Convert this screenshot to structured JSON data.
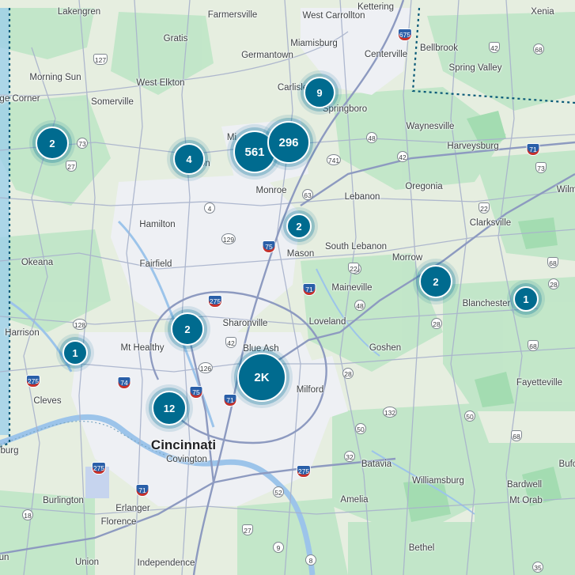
{
  "map": {
    "colors": {
      "land": "#e9efe4",
      "park": "#b9e7c4",
      "urban": "#eceef1",
      "road": "#9aa5c4",
      "water": "#a6c8ec",
      "cluster": "#006b8f",
      "boundary": "#0a5a78"
    },
    "places": [
      {
        "name": "Lakengren",
        "icon": "place-label"
      },
      {
        "name": "Farmersville",
        "icon": "place-label"
      },
      {
        "name": "West Carrollton",
        "icon": "place-label"
      },
      {
        "name": "Kettering",
        "icon": "place-label"
      },
      {
        "name": "Xenia",
        "icon": "place-label"
      },
      {
        "name": "Gratis",
        "icon": "place-label"
      },
      {
        "name": "Miamisburg",
        "icon": "place-label"
      },
      {
        "name": "Germantown",
        "icon": "place-label"
      },
      {
        "name": "Centerville",
        "icon": "place-label"
      },
      {
        "name": "Bellbrook",
        "icon": "place-label"
      },
      {
        "name": "Spring Valley",
        "icon": "place-label"
      },
      {
        "name": "Morning Sun",
        "icon": "place-label"
      },
      {
        "name": "West Elkton",
        "icon": "place-label"
      },
      {
        "name": "Carlisle",
        "icon": "place-label"
      },
      {
        "name": "ge Corner",
        "icon": "place-label"
      },
      {
        "name": "Somerville",
        "icon": "place-label"
      },
      {
        "name": "Springboro",
        "icon": "place-label"
      },
      {
        "name": "Waynesville",
        "icon": "place-label"
      },
      {
        "name": "Harveysburg",
        "icon": "place-label"
      },
      {
        "name": "Mi",
        "icon": "place-label"
      },
      {
        "name": "Trenton",
        "icon": "place-label"
      },
      {
        "name": "Oregonia",
        "icon": "place-label"
      },
      {
        "name": "Wilm",
        "icon": "place-label"
      },
      {
        "name": "Monroe",
        "icon": "place-label"
      },
      {
        "name": "Lebanon",
        "icon": "place-label"
      },
      {
        "name": "Hamilton",
        "icon": "place-label"
      },
      {
        "name": "Clarksville",
        "icon": "place-label"
      },
      {
        "name": "South Lebanon",
        "icon": "place-label"
      },
      {
        "name": "Okeana",
        "icon": "place-label"
      },
      {
        "name": "Fairfield",
        "icon": "place-label"
      },
      {
        "name": "Mason",
        "icon": "place-label"
      },
      {
        "name": "Morrow",
        "icon": "place-label"
      },
      {
        "name": "Maineville",
        "icon": "place-label"
      },
      {
        "name": "Blanchester",
        "icon": "place-label"
      },
      {
        "name": "Harrison",
        "icon": "place-label"
      },
      {
        "name": "Sharonville",
        "icon": "place-label"
      },
      {
        "name": "Loveland",
        "icon": "place-label"
      },
      {
        "name": "Mt Healthy",
        "icon": "place-label"
      },
      {
        "name": "Blue Ash",
        "icon": "place-label"
      },
      {
        "name": "Goshen",
        "icon": "place-label"
      },
      {
        "name": "Fayetteville",
        "icon": "place-label"
      },
      {
        "name": "Cleves",
        "icon": "place-label"
      },
      {
        "name": "Milford",
        "icon": "place-label"
      },
      {
        "name": "Cincinnati",
        "icon": "place-label"
      },
      {
        "name": "Covington",
        "icon": "place-label"
      },
      {
        "name": "burg",
        "icon": "place-label"
      },
      {
        "name": "Batavia",
        "icon": "place-label"
      },
      {
        "name": "Bufo",
        "icon": "place-label"
      },
      {
        "name": "Williamsburg",
        "icon": "place-label"
      },
      {
        "name": "Bardwell",
        "icon": "place-label"
      },
      {
        "name": "Burlington",
        "icon": "place-label"
      },
      {
        "name": "Erlanger",
        "icon": "place-label"
      },
      {
        "name": "Amelia",
        "icon": "place-label"
      },
      {
        "name": "Mt Orab",
        "icon": "place-label"
      },
      {
        "name": "Florence",
        "icon": "place-label"
      },
      {
        "name": "Bethel",
        "icon": "place-label"
      },
      {
        "name": "Union",
        "icon": "place-label"
      },
      {
        "name": "Independence",
        "icon": "place-label"
      },
      {
        "name": "un",
        "icon": "place-label"
      }
    ],
    "shields": [
      "127",
      "73",
      "27",
      "741",
      "48",
      "42",
      "71",
      "73",
      "63",
      "4",
      "22",
      "129",
      "75",
      "71",
      "50",
      "22",
      "275",
      "48",
      "28",
      "128",
      "42",
      "68",
      "28",
      "275",
      "126",
      "74",
      "75",
      "71",
      "28",
      "132",
      "50",
      "68",
      "50",
      "32",
      "275",
      "275",
      "52",
      "71",
      "18",
      "27",
      "9",
      "8",
      "675",
      "42",
      "68",
      "35",
      "68"
    ],
    "clusters": [
      "9",
      "561",
      "296",
      "2",
      "4",
      "2",
      "2",
      "2",
      "1",
      "1",
      "2",
      "2K",
      "12"
    ]
  }
}
